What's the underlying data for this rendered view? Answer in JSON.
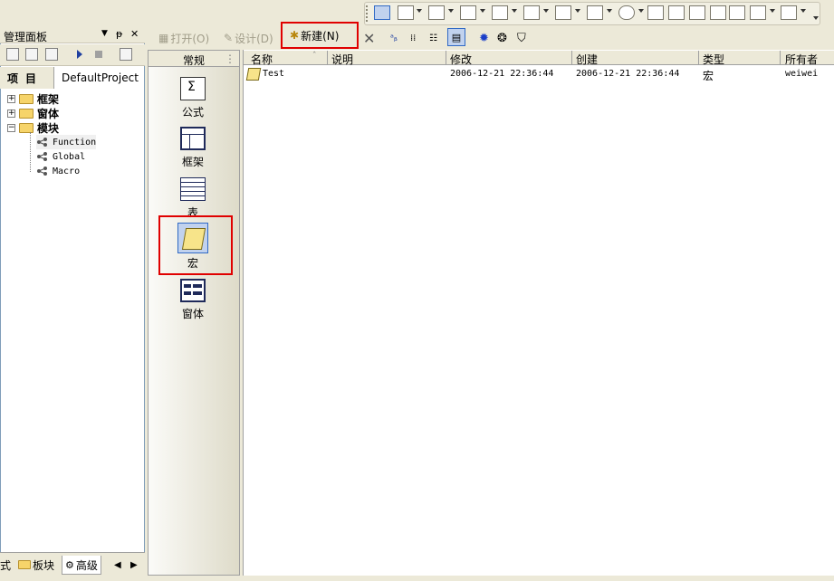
{
  "panel": {
    "title": "管理面板",
    "pin": "ᵽ",
    "close": "✕"
  },
  "project": {
    "label": "项目",
    "name": "DefaultProject"
  },
  "tree": [
    {
      "label": "框架",
      "expander": "+"
    },
    {
      "label": "窗体",
      "expander": "+"
    },
    {
      "label": "模块",
      "expander": "−"
    }
  ],
  "tree_children": [
    {
      "label": "Function"
    },
    {
      "label": "Global"
    },
    {
      "label": "Macro"
    }
  ],
  "bottom_tabs": [
    {
      "label": "式"
    },
    {
      "label": "板块"
    },
    {
      "label": "高级"
    }
  ],
  "toolbar": {
    "open": "打开(O)",
    "design": "设计(D)",
    "new": "新建(N)"
  },
  "categories_header": "常规",
  "categories": [
    {
      "label": "公式"
    },
    {
      "label": "框架"
    },
    {
      "label": "表"
    },
    {
      "label": "宏"
    },
    {
      "label": "窗体"
    }
  ],
  "list": {
    "columns": [
      "名称",
      "说明",
      "修改",
      "创建",
      "类型",
      "所有者"
    ],
    "rows": [
      {
        "name": "Test",
        "desc": "",
        "modified": "2006-12-21 22:36:44",
        "created": "2006-12-21 22:36:44",
        "type": "宏",
        "owner": "weiwei"
      }
    ]
  },
  "colors": {
    "highlight": "#e00000",
    "selection": "#c1d2ee",
    "folder": "#f6d46a"
  }
}
